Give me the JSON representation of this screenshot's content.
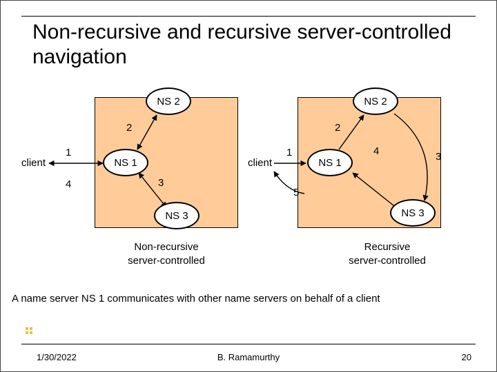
{
  "title": "Non-recursive and recursive server-controlled navigation",
  "footer": {
    "date": "1/30/2022",
    "author": "B. Ramamurthy",
    "page": "20"
  },
  "caption": "A name server NS 1 communicates with other name servers on behalf of a client",
  "left": {
    "client": "client",
    "ns1": "NS 1",
    "ns2": "NS 2",
    "ns3": "NS 3",
    "n1": "1",
    "n2": "2",
    "n3": "3",
    "n4": "4",
    "sub": "Non-recursive\nserver-controlled"
  },
  "right": {
    "client": "client",
    "ns1": "NS 1",
    "ns2": "NS 2",
    "ns3": "NS 3",
    "n1": "1",
    "n2": "2",
    "n3": "3",
    "n4": "4",
    "n5": "5",
    "sub": "Recursive\nserver-controlled"
  }
}
